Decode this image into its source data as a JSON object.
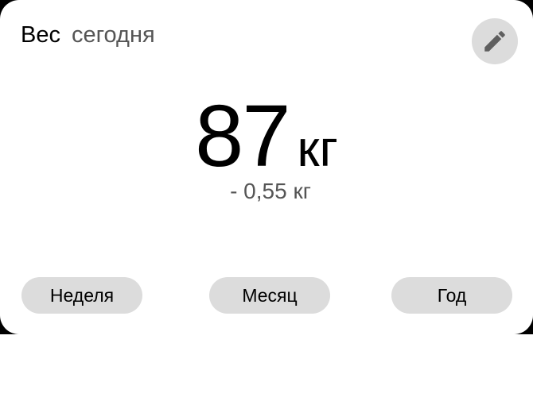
{
  "header": {
    "title": "Вес",
    "subtitle": "сегодня"
  },
  "edit_button": {
    "icon": "pencil-icon"
  },
  "weight": {
    "value": "87",
    "unit": "кг",
    "change": "- 0,55 кг"
  },
  "range_buttons": {
    "week": "Неделя",
    "month": "Месяц",
    "year": "Год"
  },
  "colors": {
    "card_background": "#ffffff",
    "button_background": "#dcdcdc",
    "secondary_text": "#555555",
    "outer_background": "#000000"
  }
}
